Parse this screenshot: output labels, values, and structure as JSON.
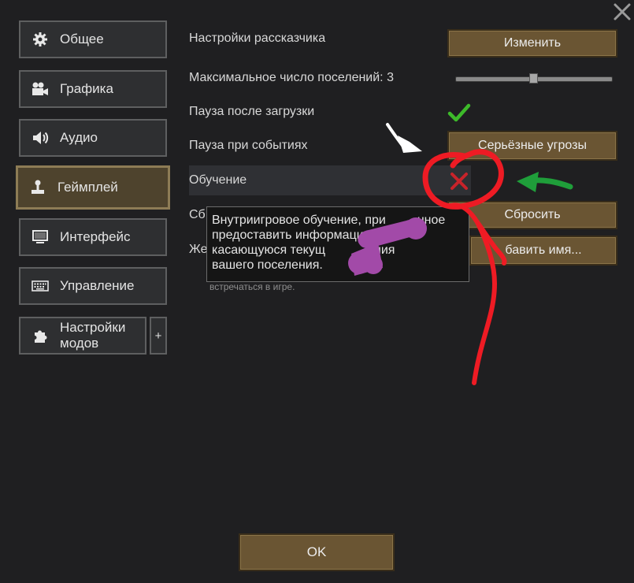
{
  "window": {
    "close_icon": "close-icon"
  },
  "sidebar": {
    "items": [
      {
        "label": "Общее",
        "icon": "gear-icon"
      },
      {
        "label": "Графика",
        "icon": "camera-icon"
      },
      {
        "label": "Аудио",
        "icon": "speaker-icon"
      },
      {
        "label": "Геймплей",
        "icon": "joystick-icon",
        "active": true
      },
      {
        "label": "Интерфейс",
        "icon": "monitor-icon"
      },
      {
        "label": "Управление",
        "icon": "keyboard-icon"
      },
      {
        "label_line1": "Настройки",
        "label_line2": "модов",
        "icon": "puzzle-icon"
      }
    ],
    "plus_label": "+"
  },
  "settings": {
    "storyteller_label": "Настройки рассказчика",
    "storyteller_button": "Изменить",
    "max_colonies_label": "Максимальное число поселений: 3",
    "max_colonies_value": 3,
    "pause_on_load_label": "Пауза после загрузки",
    "pause_on_load_checked": true,
    "pause_on_events_label": "Пауза при событиях",
    "pause_on_events_button": "Серьёзные угрозы",
    "tutorial_label": "Обучение",
    "tutorial_checked": false,
    "reset_label_partial": "Сб",
    "reset_button": "Сбросить",
    "name_label_partial": "Же",
    "name_button": "бавить имя..."
  },
  "tooltip": {
    "line1": "Внутриигровое обучение, при         нное",
    "line2": "предоставить информацию",
    "line3": "касающуюся текущ            яния",
    "line4": "вашего поселения.",
    "hint": "встречаться в игре."
  },
  "footer": {
    "ok_button": "OK"
  },
  "colors": {
    "background": "#1f1f21",
    "wood_button": "#6a5533",
    "active_tab": "#4e432d",
    "check_green": "#3dba2a",
    "cross_red": "#c8232a",
    "annotation_red": "#ee1b24",
    "annotation_green": "#1f9e3a",
    "annotation_purple": "#a24aa8"
  }
}
